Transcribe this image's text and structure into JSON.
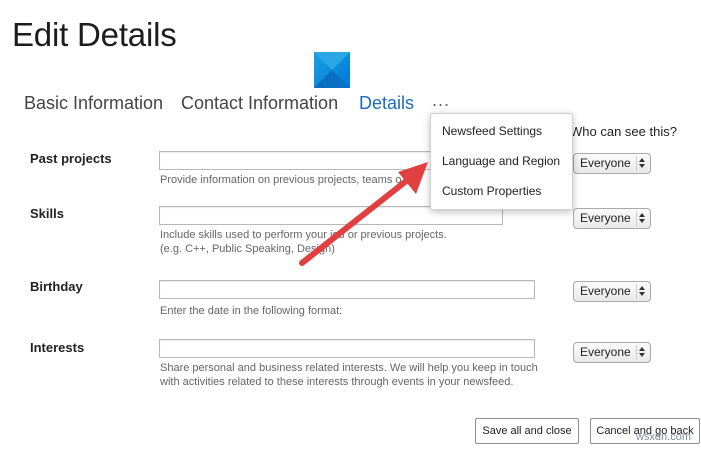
{
  "page": {
    "title": "Edit Details"
  },
  "tabs": [
    {
      "label": "Basic Information",
      "active": false
    },
    {
      "label": "Contact Information",
      "active": false
    },
    {
      "label": "Details",
      "active": true
    }
  ],
  "more_label": "...",
  "visibility_header": "Who can see this?",
  "fields": [
    {
      "label": "Past projects",
      "value": "",
      "help": [
        "Provide information on previous projects, teams o"
      ],
      "visibility": "Everyone"
    },
    {
      "label": "Skills",
      "value": "",
      "help": [
        "Include skills used to perform your job or previous projects.",
        "(e.g. C++, Public Speaking, Design)"
      ],
      "visibility": "Everyone"
    },
    {
      "label": "Birthday",
      "value": "",
      "help": [
        "Enter the date in the following format:"
      ],
      "visibility": "Everyone"
    },
    {
      "label": "Interests",
      "value": "",
      "help": [
        "Share personal and business related interests. We will help you keep in touch",
        "with activities related to these interests through events in your newsfeed."
      ],
      "visibility": "Everyone"
    }
  ],
  "menu": {
    "items": [
      "Newsfeed Settings",
      "Language and Region",
      "Custom Properties"
    ]
  },
  "buttons": {
    "save": "Save all and close",
    "cancel": "Cancel and go back"
  },
  "colors": {
    "active_tab": "#1e6bb8",
    "arrow": "#e0403f"
  },
  "watermark": "wsxdn.com"
}
